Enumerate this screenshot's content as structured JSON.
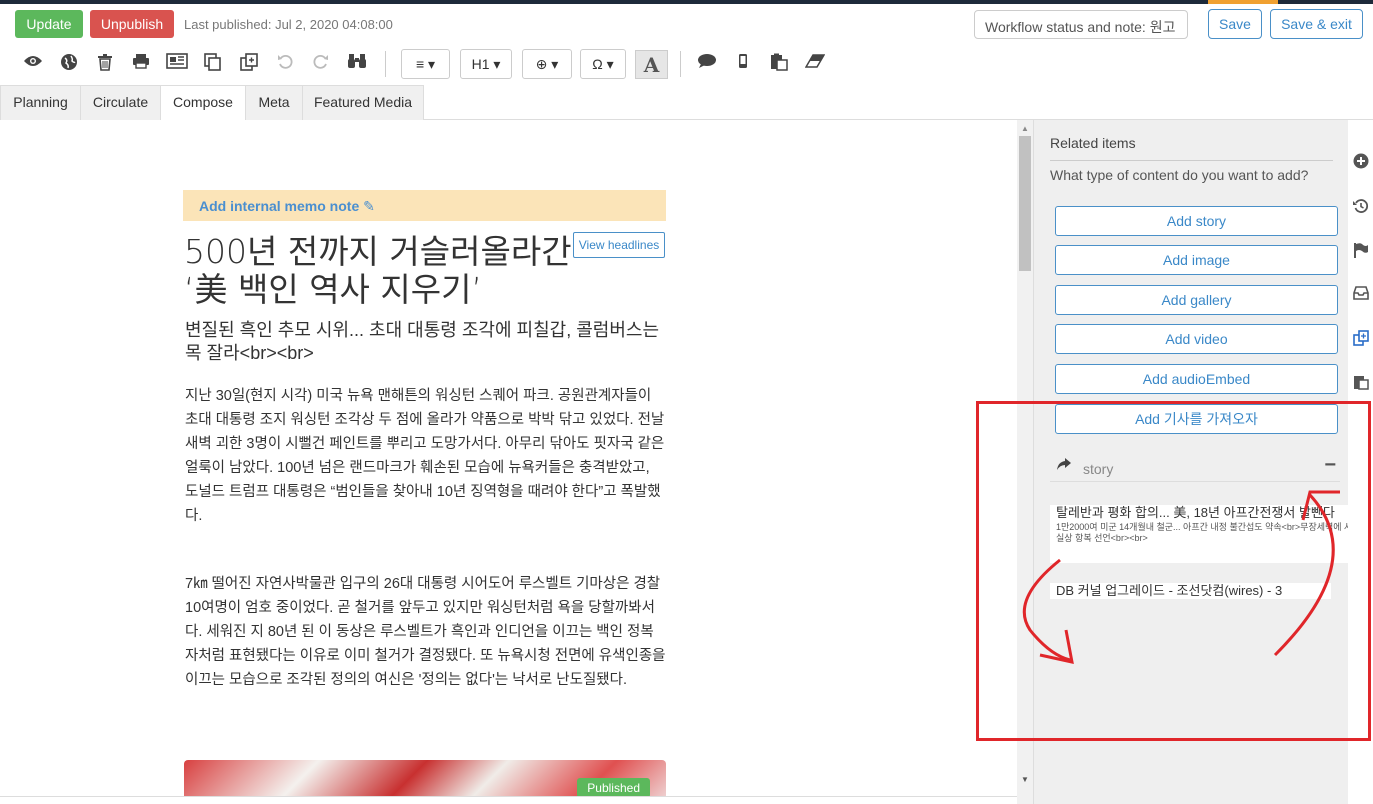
{
  "topbar": {
    "update_label": "Update",
    "unpublish_label": "Unpublish",
    "last_published": "Last published: Jul 2, 2020 04:08:00",
    "workflow_status": "Workflow status and note: 원고",
    "save_label": "Save",
    "save_exit_label": "Save & exit"
  },
  "toolbar": {
    "align_label": "≡ ▾",
    "heading_label": "H1 ▾",
    "special_label": "⊕ ▾",
    "omega_label": "Ω ▾",
    "font_label": "A"
  },
  "tabs": [
    "Planning",
    "Circulate",
    "Compose",
    "Meta",
    "Featured Media"
  ],
  "active_tab": "Compose",
  "editor": {
    "memo_label": "Add internal memo note ✎",
    "headline": "500년 전까지 거슬러올라간 ‘美 백인 역사 지우기’",
    "view_headlines_label": "View headlines",
    "subheadline": "변질된 흑인 추모 시위... 초대 대통령 조각에 피칠갑, 콜럼버스는 목 잘라<br><br>",
    "paragraphs": [
      "지난 30일(현지 시각) 미국 뉴욕 맨해튼의 워싱턴 스퀘어 파크. 공원관계자들이 초대 대통령 조지 워싱턴 조각상 두 점에 올라가 약품으로 박박 닦고 있었다. 전날 새벽 괴한 3명이 시뻘건 페인트를 뿌리고 도망가서다. 아무리 닦아도 핏자국 같은 얼룩이 남았다. 100년 넘은 랜드마크가 훼손된 모습에 뉴욕커들은 충격받았고, 도널드 트럼프 대통령은 “범인들을 찾아내 10년 징역형을 때려야 한다”고 폭발했다.",
      "7㎞ 떨어진 자연사박물관 입구의 26대 대통령 시어도어 루스벨트 기마상은 경찰 10여명이 엄호 중이었다. 곧 철거를 앞두고 있지만 워싱턴처럼 욕을 당할까봐서다. 세워진 지 80년 된 이 동상은 루스벨트가 흑인과 인디언을 이끄는 백인 정복자처럼 표현됐다는 이유로 이미 철거가 결정됐다. 또 뉴욕시청 전면에 유색인종을 이끄는 모습으로 조각된 정의의 여신은 '정의는 없다'는 낙서로 난도질됐다."
    ],
    "image_badge": "Published"
  },
  "panel": {
    "title": "Related items",
    "question": "What type of content do you want to add?",
    "add_buttons": [
      "Add story",
      "Add image",
      "Add gallery",
      "Add video",
      "Add audioEmbed",
      "Add 기사를 가져오자"
    ],
    "story_label": "story",
    "related": [
      {
        "title": "탈레반과 평화 합의... 美, 18년 아프간전쟁서 발뺀다",
        "summary": "1만2000여 미군 14개월내 철군... 아프간 내정 불간섭도 약속<br>무장세력에 사실상 항복 선언<br><br>"
      },
      {
        "title": "DB 커널 업그레이드 - 조선닷컴(wires) - 3",
        "summary": ""
      }
    ]
  },
  "colors": {
    "update": "#5cb85c",
    "unpublish": "#d9534f",
    "accent_blue": "#3a88c8",
    "memo_bg": "#fbe4b8",
    "annotation": "#e0262a"
  }
}
